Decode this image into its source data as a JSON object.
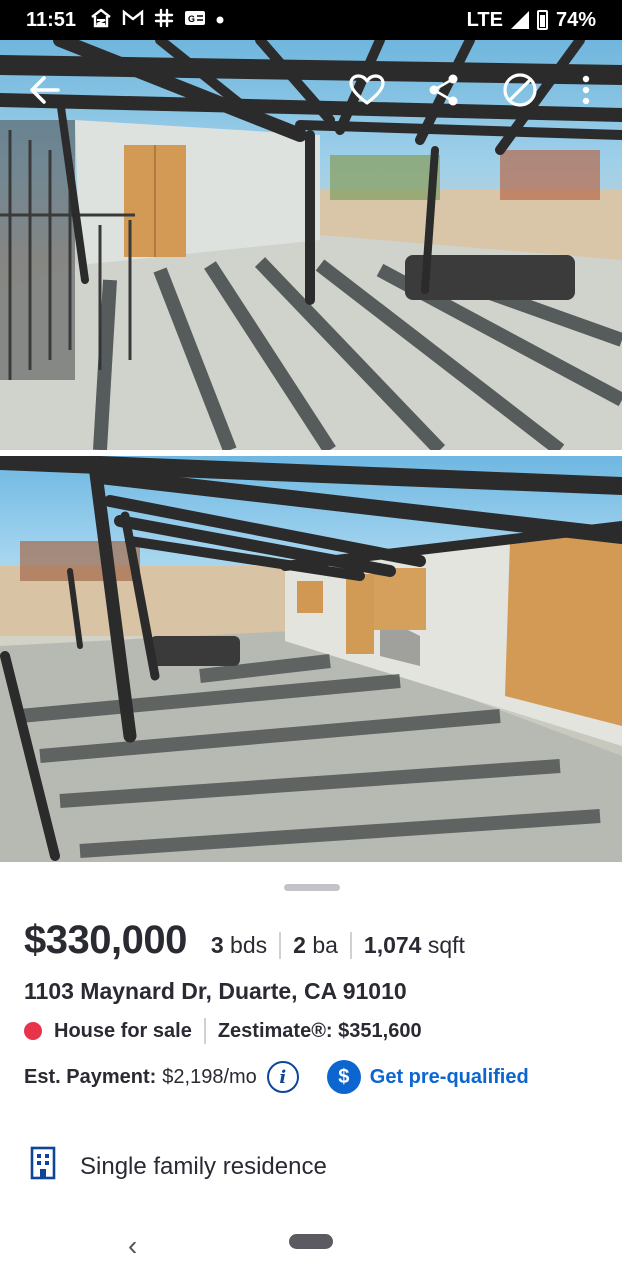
{
  "status_bar": {
    "time": "11:51",
    "network": "LTE",
    "battery": "74%"
  },
  "photo_toolbar": {
    "icons": [
      "back-arrow-icon",
      "heart-icon",
      "share-icon",
      "hide-icon",
      "more-vert-icon"
    ]
  },
  "listing": {
    "price": "$330,000",
    "beds_value": "3",
    "beds_unit": "bds",
    "baths_value": "2",
    "baths_unit": "ba",
    "sqft_value": "1,074",
    "sqft_unit": "sqft",
    "address": "1103 Maynard Dr, Duarte, CA 91010",
    "status": "House for sale",
    "status_color": "#e8344a",
    "zestimate": "Zestimate®: $351,600",
    "est_payment_label": "Est. Payment:",
    "est_payment_value": "$2,198/mo",
    "prequalify_label": "Get pre-qualified",
    "accent_color": "#0d66d0",
    "property_type": "Single family residence"
  }
}
